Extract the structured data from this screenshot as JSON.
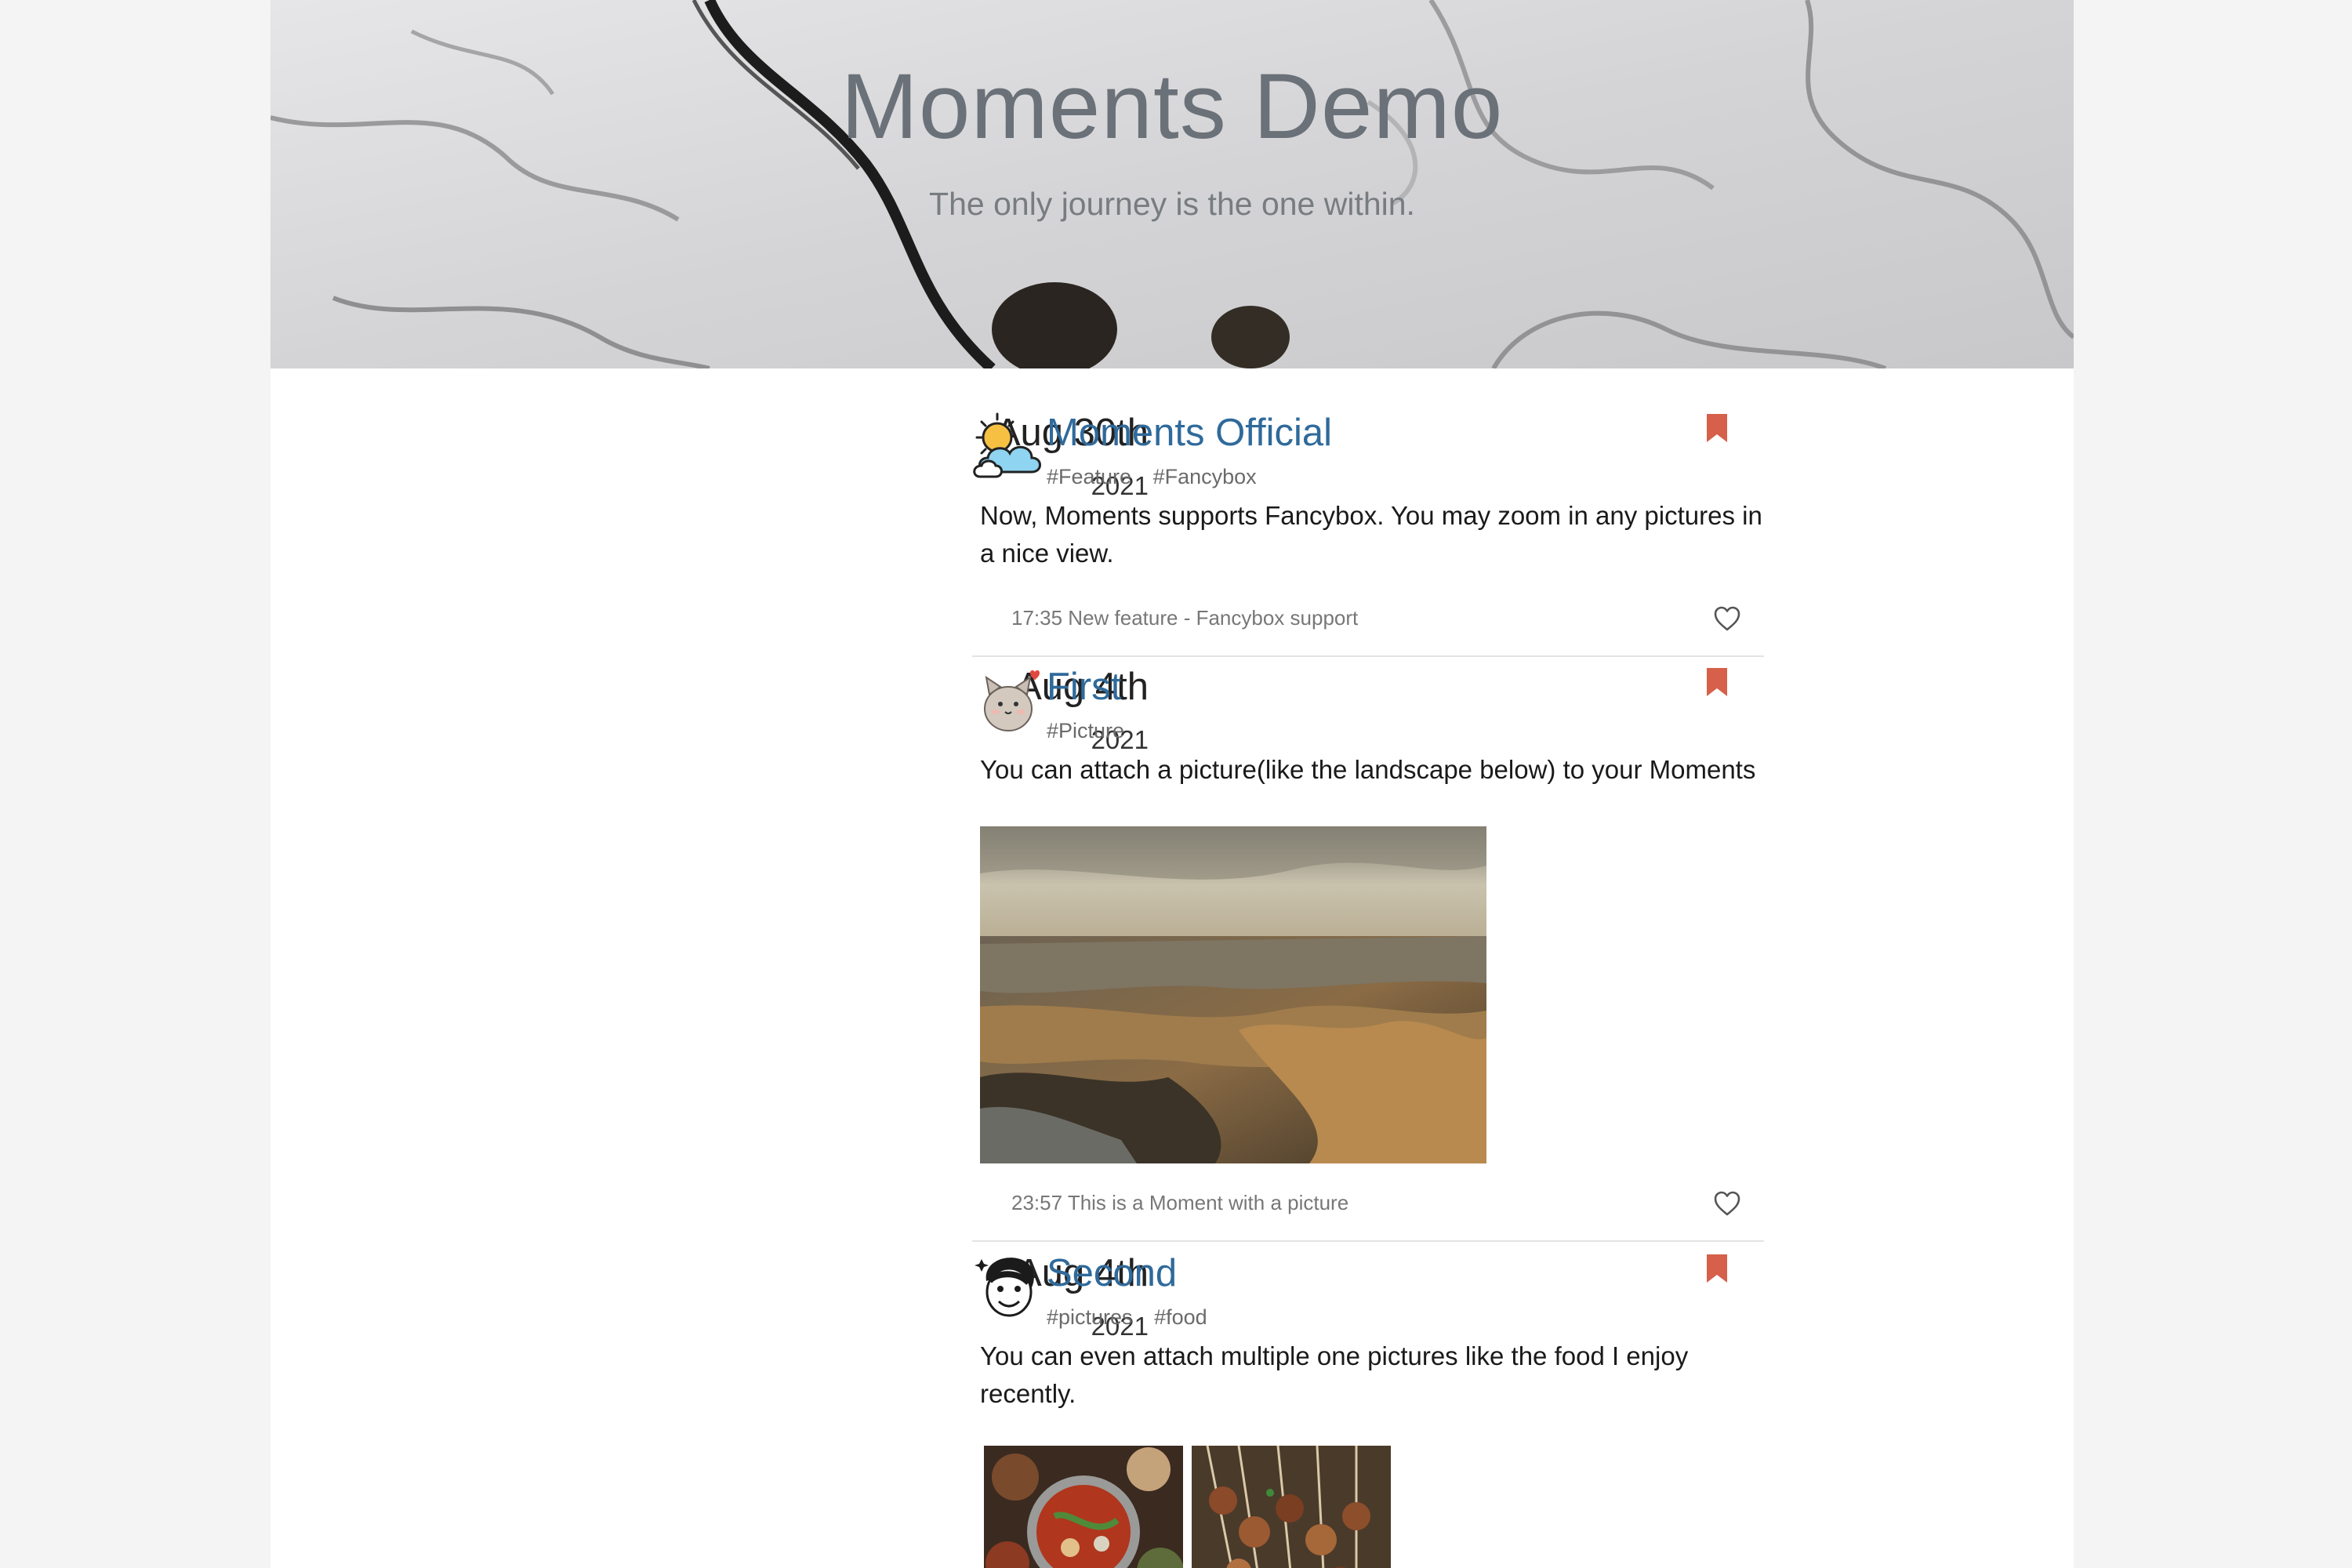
{
  "site": {
    "title": "Moments Demo",
    "subtitle": "The only journey is the one within."
  },
  "colors": {
    "author_link": "#2f6a9b",
    "bookmark": "#d6604a",
    "divider": "#e3e3e3"
  },
  "posts": [
    {
      "date_day": "Aug 30th",
      "date_year": "2021",
      "author": "Moments Official",
      "avatar_icon": "sun-cloud-icon",
      "tags": [
        "#Feature",
        "#Fancybox"
      ],
      "content": "Now, Moments supports Fancybox. You may zoom in any pictures in a nice view.",
      "footer": "17:35 New feature - Fancybox support"
    },
    {
      "date_day": "Aug 4th",
      "date_year": "2021",
      "author": "First",
      "avatar_icon": "cat-avatar-icon",
      "tags": [
        "#Picture"
      ],
      "content": "You can attach a picture(like the landscape below) to your Moments",
      "images": [
        "canyon-landscape-photo"
      ],
      "footer": "23:57 This is a Moment with a picture"
    },
    {
      "date_day": "Aug 4th",
      "date_year": "2021",
      "author": "Second",
      "avatar_icon": "cartoon-face-icon",
      "tags": [
        "#pictures",
        "#food"
      ],
      "content": "You can even attach multiple one pictures like the food I enjoy recently.",
      "images": [
        "hotpot-food-photo",
        "skewers-food-photo"
      ]
    }
  ]
}
